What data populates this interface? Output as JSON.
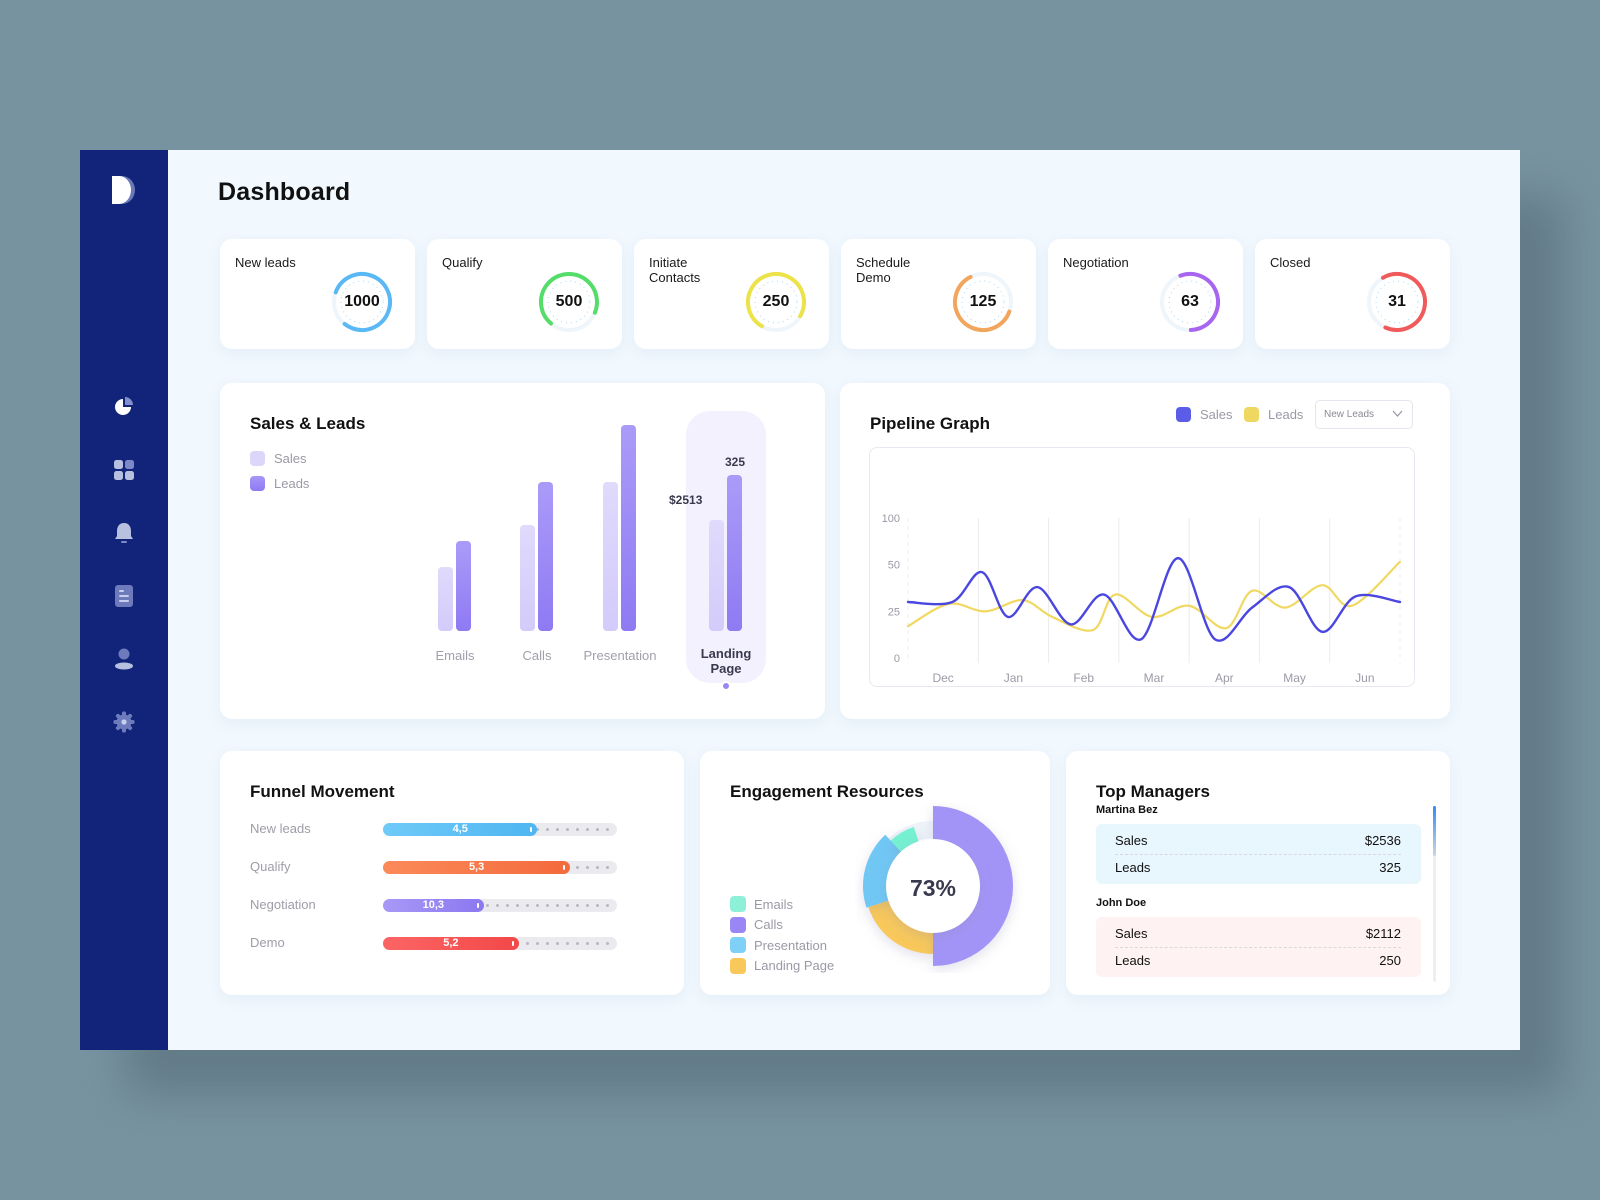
{
  "app": {
    "title": "Dashboard"
  },
  "sidebar": {
    "logo": "d-logo-icon",
    "items": [
      {
        "name": "analytics",
        "icon": "pie-chart-icon",
        "active": true
      },
      {
        "name": "apps",
        "icon": "grid-icon",
        "active": false
      },
      {
        "name": "notifications",
        "icon": "bell-icon",
        "active": false
      },
      {
        "name": "documents",
        "icon": "document-icon",
        "active": false
      },
      {
        "name": "profile",
        "icon": "user-icon",
        "active": false
      },
      {
        "name": "settings",
        "icon": "gear-icon",
        "active": false
      }
    ]
  },
  "kpis": [
    {
      "label": "New leads",
      "value": "1000",
      "progress": 0.8,
      "color": "#5ab8f5"
    },
    {
      "label": "Qualify",
      "value": "500",
      "progress": 0.7,
      "color": "#55dd6a"
    },
    {
      "label": "Initiate Contacts",
      "value": "250",
      "progress": 0.75,
      "color": "#ece24a"
    },
    {
      "label": "Schedule Demo",
      "value": "125",
      "progress": 0.62,
      "color": "#f2a55c"
    },
    {
      "label": "Negotiation",
      "value": "63",
      "progress": 0.55,
      "color": "#a865f0"
    },
    {
      "label": "Closed",
      "value": "31",
      "progress": 0.65,
      "color": "#f05a5a"
    }
  ],
  "sales_leads": {
    "title": "Sales & Leads",
    "legend": [
      {
        "label": "Sales",
        "color": "#d9d2fb"
      },
      {
        "label": "Leads",
        "color": "#9680f5"
      }
    ],
    "highlight_sales_label": "$2513",
    "highlight_leads_label": "325"
  },
  "pipeline": {
    "title": "Pipeline Graph",
    "legend": [
      {
        "label": "Sales",
        "color": "#5b5ce8"
      },
      {
        "label": "Leads",
        "color": "#efd862"
      }
    ],
    "dropdown": {
      "selected": "New Leads"
    }
  },
  "funnel": {
    "title": "Funnel Movement",
    "rows": [
      {
        "label": "New leads",
        "value": "4,5",
        "fraction": 0.66,
        "color_from": "#6fcaf8",
        "color_to": "#4fb6f1",
        "dots": 8
      },
      {
        "label": "Qualify",
        "value": "5,3",
        "fraction": 0.8,
        "color_from": "#fb8a5a",
        "color_to": "#f46a3c",
        "dots": 4
      },
      {
        "label": "Negotiation",
        "value": "10,3",
        "fraction": 0.43,
        "color_from": "#a899f7",
        "color_to": "#8b78f0",
        "dots": 13
      },
      {
        "label": "Demo",
        "value": "5,2",
        "fraction": 0.58,
        "color_from": "#fc6565",
        "color_to": "#f24848",
        "dots": 10
      }
    ]
  },
  "engagement": {
    "title": "Engagement Resources",
    "center_label": "73%",
    "legend": [
      {
        "label": "Emails",
        "color": "#8ef0d8"
      },
      {
        "label": "Calls",
        "color": "#9b86f5"
      },
      {
        "label": "Presentation",
        "color": "#7fd0f7"
      },
      {
        "label": "Landing Page",
        "color": "#f9c85a"
      }
    ]
  },
  "managers": {
    "title": "Top Managers",
    "list": [
      {
        "name": "Martina Bez",
        "sales_label": "Sales",
        "sales": "$2536",
        "leads_label": "Leads",
        "leads": "325",
        "bg": "#e8f6fe"
      },
      {
        "name": "John Doe",
        "sales_label": "Sales",
        "sales": "$2112",
        "leads_label": "Leads",
        "leads": "250",
        "bg": "#fef2f2"
      }
    ]
  },
  "chart_data": [
    {
      "type": "bar",
      "title": "Sales & Leads",
      "categories": [
        "Emails",
        "Calls",
        "Presentation",
        "Landing Page"
      ],
      "series": [
        {
          "name": "Sales",
          "values": [
            65,
            107,
            150,
            112
          ]
        },
        {
          "name": "Leads",
          "values": [
            91,
            150,
            208,
            157
          ]
        }
      ],
      "highlighted_category": "Landing Page",
      "annotations": [
        {
          "category": "Landing Page",
          "series": "Sales",
          "text": "$2513"
        },
        {
          "category": "Landing Page",
          "series": "Leads",
          "text": "325"
        }
      ],
      "ylim": [
        0,
        210
      ],
      "legend": "top-left"
    },
    {
      "type": "line",
      "title": "Pipeline Graph",
      "x": [
        "Dec",
        "Jan",
        "Feb",
        "Mar",
        "Apr",
        "May",
        "Jun"
      ],
      "yticks": [
        "0",
        "25",
        "50",
        "100"
      ],
      "ylim": [
        0,
        100
      ],
      "series": [
        {
          "name": "Sales",
          "color": "#4a46e0",
          "points": [
            [
              0,
              30
            ],
            [
              0.6,
              30
            ],
            [
              1.0,
              46
            ],
            [
              1.35,
              22
            ],
            [
              1.75,
              38
            ],
            [
              2.2,
              18
            ],
            [
              2.65,
              34
            ],
            [
              3.15,
              10
            ],
            [
              3.65,
              57
            ],
            [
              4.15,
              10
            ],
            [
              4.65,
              27
            ],
            [
              5.15,
              38
            ],
            [
              5.6,
              14
            ],
            [
              6.05,
              33
            ],
            [
              6.65,
              30
            ]
          ]
        },
        {
          "name": "Leads",
          "color": "#f0d861",
          "points": [
            [
              0,
              17
            ],
            [
              0.55,
              29
            ],
            [
              1.05,
              25
            ],
            [
              1.55,
              31
            ],
            [
              1.95,
              22
            ],
            [
              2.5,
              15
            ],
            [
              2.8,
              34
            ],
            [
              3.3,
              22
            ],
            [
              3.8,
              28
            ],
            [
              4.3,
              16
            ],
            [
              4.65,
              36
            ],
            [
              5.1,
              27
            ],
            [
              5.6,
              39
            ],
            [
              6.0,
              28
            ],
            [
              6.65,
              53
            ]
          ]
        }
      ],
      "grid": true,
      "legend": "top-right"
    },
    {
      "type": "pie",
      "title": "Engagement Resources",
      "categories": [
        "Calls",
        "Landing Page",
        "Presentation",
        "Emails"
      ],
      "values": [
        50,
        20,
        18,
        7
      ],
      "center_text": "73%"
    }
  ]
}
